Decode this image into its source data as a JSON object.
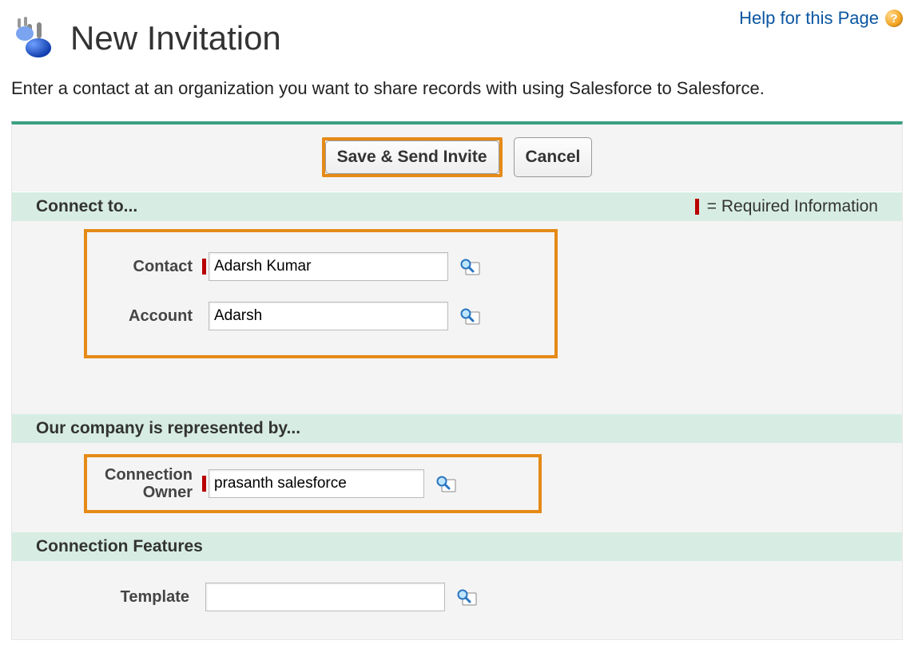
{
  "help": {
    "label": "Help for this Page"
  },
  "page": {
    "title": "New Invitation",
    "description": "Enter a contact at an organization you want to share records with using Salesforce to Salesforce."
  },
  "buttons": {
    "save_send": "Save & Send Invite",
    "cancel": "Cancel"
  },
  "required_note": "= Required Information",
  "sections": {
    "connect_to": {
      "title": "Connect to...",
      "fields": {
        "contact": {
          "label": "Contact",
          "value": "Adarsh Kumar",
          "required": true
        },
        "account": {
          "label": "Account",
          "value": "Adarsh",
          "required": false
        }
      }
    },
    "represented_by": {
      "title": "Our company is represented by...",
      "fields": {
        "connection_owner": {
          "label": "Connection Owner",
          "value": "prasanth salesforce",
          "required": true
        }
      }
    },
    "connection_features": {
      "title": "Connection Features",
      "fields": {
        "template": {
          "label": "Template",
          "value": "",
          "required": false
        }
      }
    }
  }
}
